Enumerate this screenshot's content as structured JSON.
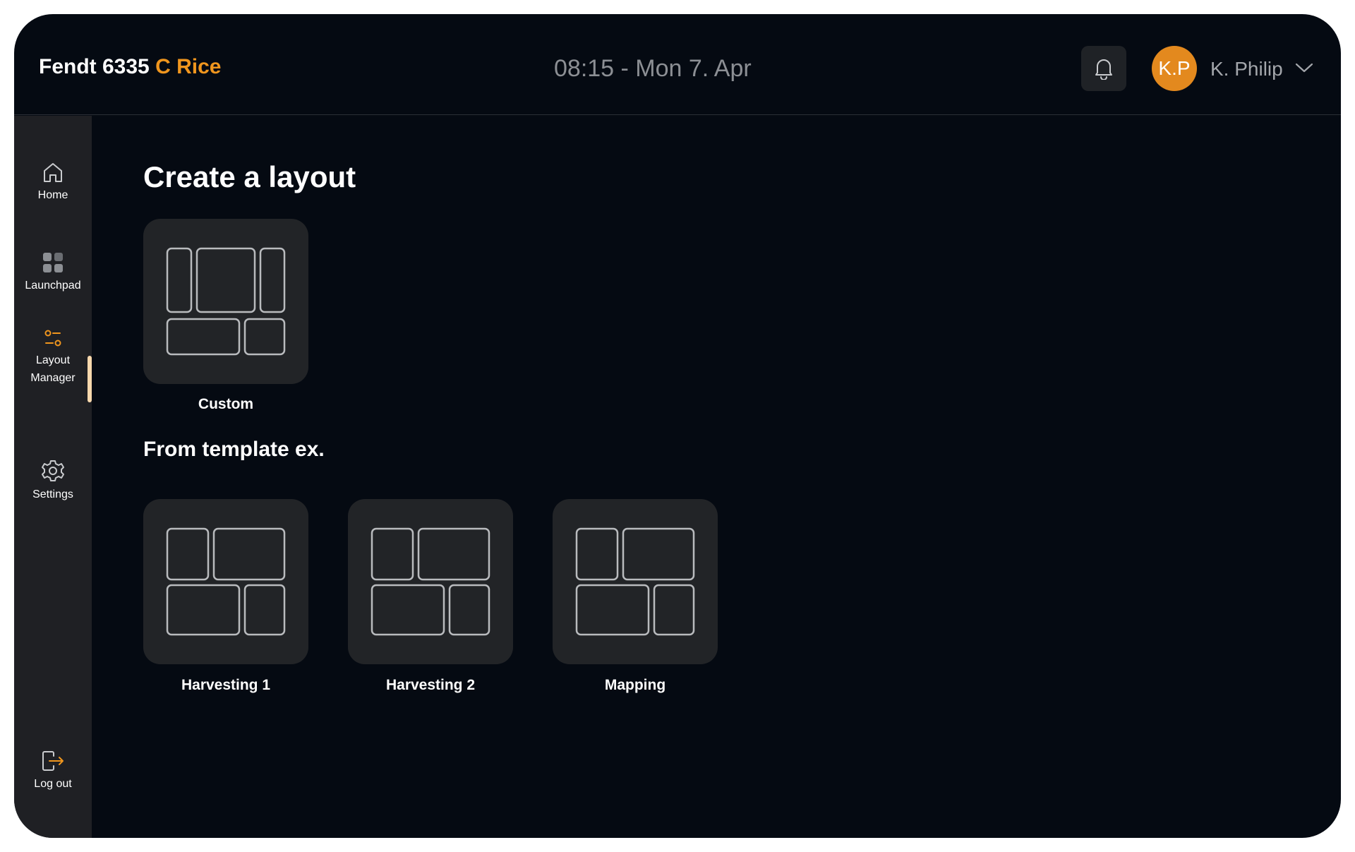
{
  "header": {
    "brand_main": "Fendt 6335",
    "brand_accent": "C Rice",
    "datetime": "08:15 - Mon 7. Apr",
    "notifications_icon": "bell-icon",
    "user": {
      "initials": "K.P",
      "name": "K. Philip",
      "menu_icon": "chevron-down-icon"
    }
  },
  "sidebar": {
    "items": [
      {
        "label": "Home",
        "icon": "home-icon"
      },
      {
        "label": "Launchpad",
        "icon": "grid-icon"
      },
      {
        "label_line1": "Layout",
        "label_line2": "Manager",
        "icon": "sliders-icon",
        "active": true
      },
      {
        "label": "Settings",
        "icon": "gear-icon"
      }
    ],
    "logout": {
      "label": "Log out",
      "icon": "logout-icon"
    }
  },
  "main": {
    "title": "Create a layout",
    "custom_card": {
      "label": "Custom"
    },
    "templates_title": "From template ex.",
    "templates": [
      {
        "label": "Harvesting  1"
      },
      {
        "label": "Harvesting 2"
      },
      {
        "label": "Mapping"
      }
    ]
  },
  "colors": {
    "background": "#050a12",
    "sidebar": "#1f2024",
    "card": "#222427",
    "accent": "#f0961e",
    "active_indicator": "#f8d8ad",
    "text": "#ffffff",
    "muted_text": "#8c8f94"
  }
}
